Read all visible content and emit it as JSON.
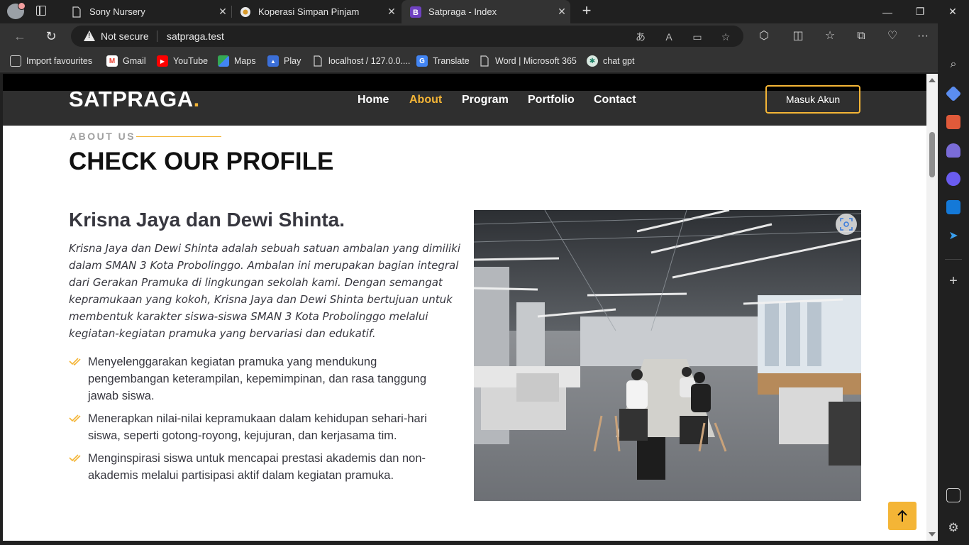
{
  "browser": {
    "tabs": [
      {
        "label": "Sony Nursery",
        "icon": "page-icon"
      },
      {
        "label": "Koperasi Simpan Pinjam",
        "icon": "site-favicon"
      },
      {
        "label": "Satpraga - Index",
        "icon": "bootstrap-favicon",
        "active": true
      }
    ],
    "security_label": "Not secure",
    "url": "satpraga.test",
    "bookmarks": [
      {
        "label": "Import favourites",
        "icon": "import-icon"
      },
      {
        "label": "Gmail",
        "icon": "gmail-icon"
      },
      {
        "label": "YouTube",
        "icon": "youtube-icon"
      },
      {
        "label": "Maps",
        "icon": "maps-icon"
      },
      {
        "label": "Play",
        "icon": "play-icon"
      },
      {
        "label": "localhost / 127.0.0....",
        "icon": "page-icon"
      },
      {
        "label": "Translate",
        "icon": "translate-icon"
      },
      {
        "label": "Word | Microsoft 365",
        "icon": "page-icon"
      },
      {
        "label": "chat gpt",
        "icon": "chatgpt-icon"
      }
    ]
  },
  "site": {
    "logo_text": "SATPRAGA",
    "logo_dot": ".",
    "nav": [
      {
        "label": "Home",
        "active": false
      },
      {
        "label": "About",
        "active": true
      },
      {
        "label": "Program",
        "active": false
      },
      {
        "label": "Portfolio",
        "active": false
      },
      {
        "label": "Contact",
        "active": false
      }
    ],
    "login_label": "Masuk Akun",
    "accent_color": "#f4b536"
  },
  "about": {
    "subtitle": "ABOUT US",
    "title": "CHECK OUR PROFILE",
    "heading": "Krisna Jaya dan Dewi Shinta.",
    "description": "Krisna Jaya dan Dewi Shinta adalah sebuah satuan ambalan yang dimiliki dalam SMAN 3 Kota Probolinggo. Ambalan ini merupakan bagian integral dari Gerakan Pramuka di lingkungan sekolah kami. Dengan semangat kepramukaan yang kokoh, Krisna Jaya dan Dewi Shinta bertujuan untuk membentuk karakter siswa-siswa SMAN 3 Kota Probolinggo melalui kegiatan-kegiatan pramuka yang bervariasi dan edukatif.",
    "points": [
      "Menyelenggarakan kegiatan pramuka yang mendukung pengembangan keterampilan, kepemimpinan, dan rasa tanggung jawab siswa.",
      "Menerapkan nilai-nilai kepramukaan dalam kehidupan sehari-hari siswa, seperti gotong-royong, kejujuran, dan kerjasama tim.",
      "Menginspirasi siswa untuk mencapai prestasi akademis dan non-akademis melalui partisipasi aktif dalam kegiatan pramuka."
    ]
  }
}
